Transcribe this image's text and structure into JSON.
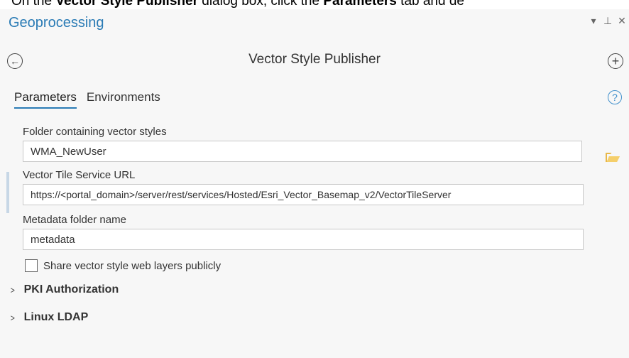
{
  "caption": {
    "prefix": "On the",
    "bold1": "Vector Style Publisher",
    "middle": "dialog box, click the",
    "bold2": "Parameters",
    "suffix": "tab and de"
  },
  "pane": {
    "title": "Geoprocessing",
    "controls": [
      "▾",
      "⊥",
      "✕"
    ]
  },
  "tool": {
    "title": "Vector Style Publisher",
    "back_icon": "←",
    "add_icon": "+"
  },
  "tabs": [
    {
      "label": "Parameters",
      "active": true
    },
    {
      "label": "Environments",
      "active": false
    }
  ],
  "help_icon": "?",
  "params": {
    "folder": {
      "label": "Folder containing vector styles",
      "value": "WMA_NewUser"
    },
    "url": {
      "label": "Vector Tile Service URL",
      "value": "https://<portal_domain>/server/rest/services/Hosted/Esri_Vector_Basemap_v2/VectorTileServer"
    },
    "metadata": {
      "label": "Metadata folder name",
      "value": "metadata"
    }
  },
  "checkbox": {
    "label": "Share vector style web layers publicly",
    "checked": false
  },
  "sections": [
    {
      "label": "PKI Authorization"
    },
    {
      "label": "Linux LDAP"
    }
  ],
  "colors": {
    "accent": "#2a7bb5",
    "folder_icon": "#e8b84a"
  }
}
